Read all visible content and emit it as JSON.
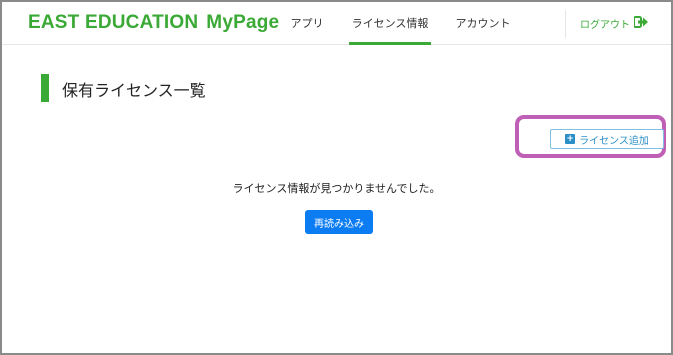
{
  "header": {
    "brand_text": "EAST EDUCATION",
    "brand_suffix": "MyPage",
    "nav": [
      {
        "label": "アプリ",
        "active": false
      },
      {
        "label": "ライセンス情報",
        "active": true
      },
      {
        "label": "アカウント",
        "active": false
      }
    ],
    "logout_label": "ログアウト",
    "logout_icon": "sign-out-icon"
  },
  "main": {
    "title": "保有ライセンス一覧",
    "add_license_label": "ライセンス追加",
    "add_license_icon": "plus-square-icon",
    "empty_message": "ライセンス情報が見つかりませんでした。",
    "reload_label": "再読み込み"
  },
  "colors": {
    "brand_green": "#3aa935",
    "reload_blue": "#0b7cf2",
    "add_button_blue": "#2b8fc6",
    "highlight_ring": "#bf5fb6"
  }
}
